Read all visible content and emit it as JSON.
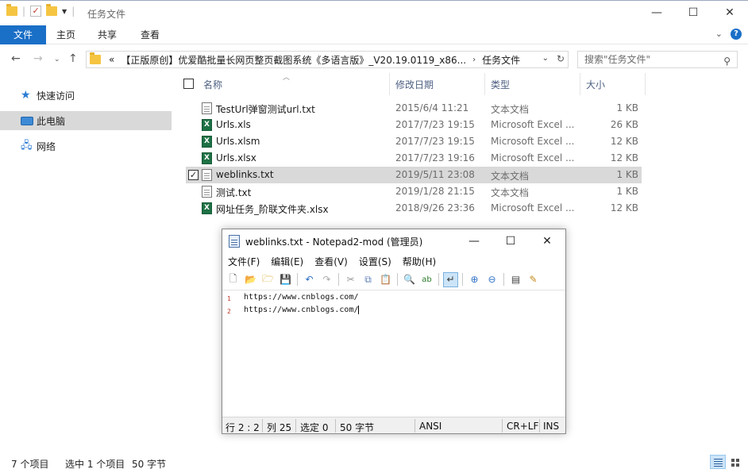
{
  "window": {
    "title": "任务文件",
    "buttons": {
      "minimize": "—",
      "maximize": "☐",
      "close": "✕"
    }
  },
  "ribbon": {
    "tabs": [
      "文件",
      "主页",
      "共享",
      "查看"
    ],
    "active_tab": 0,
    "help": "?"
  },
  "address": {
    "overflow": "«",
    "crumbs": [
      "【正版原创】优爱酷批量长网页整页截图系统《多语言版》_V20.19.0119_x86...",
      "任务文件"
    ],
    "search_placeholder": "搜索\"任务文件\""
  },
  "navpane": {
    "items": [
      {
        "label": "快速访问",
        "icon": "star-icon"
      },
      {
        "label": "此电脑",
        "icon": "computer-icon",
        "selected": true
      },
      {
        "label": "网络",
        "icon": "network-icon"
      }
    ]
  },
  "filelist": {
    "columns": [
      "名称",
      "修改日期",
      "类型",
      "大小"
    ],
    "rows": [
      {
        "name": "TestUrl弹窗测试url.txt",
        "date": "2015/6/4 11:21",
        "type": "文本文档",
        "size": "1 KB",
        "icon": "text-file-icon",
        "selected": false
      },
      {
        "name": "Urls.xls",
        "date": "2017/7/23 19:15",
        "type": "Microsoft Excel ...",
        "size": "26 KB",
        "icon": "excel-file-icon",
        "selected": false
      },
      {
        "name": "Urls.xlsm",
        "date": "2017/7/23 19:15",
        "type": "Microsoft Excel ...",
        "size": "12 KB",
        "icon": "excel-file-icon",
        "selected": false
      },
      {
        "name": "Urls.xlsx",
        "date": "2017/7/23 19:16",
        "type": "Microsoft Excel ...",
        "size": "12 KB",
        "icon": "excel-file-icon",
        "selected": false
      },
      {
        "name": "weblinks.txt",
        "date": "2019/5/11 23:08",
        "type": "文本文档",
        "size": "1 KB",
        "icon": "text-file-icon",
        "selected": true
      },
      {
        "name": "测试.txt",
        "date": "2019/1/28 21:15",
        "type": "文本文档",
        "size": "1 KB",
        "icon": "text-file-icon",
        "selected": false
      },
      {
        "name": "网址任务_阶联文件夹.xlsx",
        "date": "2018/9/26 23:36",
        "type": "Microsoft Excel ...",
        "size": "12 KB",
        "icon": "excel-file-icon",
        "selected": false
      }
    ]
  },
  "statusbar": {
    "item_count": "7 个项目",
    "selected": "选中 1 个项目",
    "size": "50 字节"
  },
  "notepad": {
    "title": "weblinks.txt - Notepad2-mod (管理员)",
    "menu": [
      "文件(F)",
      "编辑(E)",
      "查看(V)",
      "设置(S)",
      "帮助(H)"
    ],
    "lines": [
      "https://www.cnblogs.com/",
      "https://www.cnblogs.com/"
    ],
    "line_numbers": [
      "1",
      "2"
    ],
    "status": {
      "position": "行 2 : 2",
      "column": "列 25",
      "selection": "选定 0",
      "bytes": "50 字节",
      "encoding": "ANSI",
      "eol": "CR+LF",
      "mode": "INS"
    }
  },
  "colors": {
    "accent": "#1a6fc7",
    "selection": "#d9d9d9",
    "excel": "#1e7145",
    "line_number": "#c0392b"
  }
}
